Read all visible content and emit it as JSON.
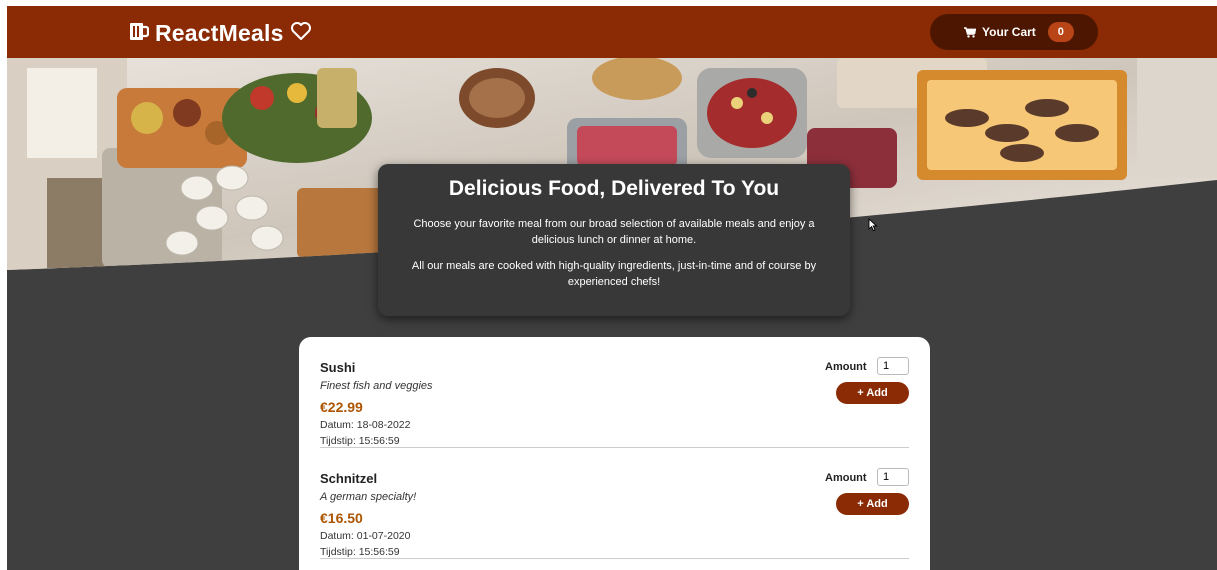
{
  "header": {
    "brand": "ReactMeals",
    "brand_icon": "beer-mug-icon",
    "brand_suffix_icon": "heart-outline-icon",
    "cart_label": "Your Cart",
    "cart_icon": "shopping-cart-icon",
    "cart_count": "0"
  },
  "summary": {
    "title": "Delicious Food, Delivered To You",
    "paragraph1": "Choose your favorite meal from our broad selection of available meals and enjoy a delicious lunch or dinner at home.",
    "paragraph2": "All our meals are cooked with high-quality ingredients, just-in-time and of course by experienced chefs!"
  },
  "meals": [
    {
      "name": "Sushi",
      "description": "Finest fish and veggies",
      "price": "€22.99",
      "date": "Datum: 18-08-2022",
      "time": "Tijdstip: 15:56:59",
      "amount_label": "Amount",
      "amount_value": "1",
      "add_label": "+ Add"
    },
    {
      "name": "Schnitzel",
      "description": "A german specialty!",
      "price": "€16.50",
      "date": "Datum: 01-07-2020",
      "time": "Tijdstip: 15:56:59",
      "amount_label": "Amount",
      "amount_value": "1",
      "add_label": "+ Add"
    }
  ],
  "colors": {
    "header": "#8a2b06",
    "cart_button": "#4d1601",
    "badge": "#b94517",
    "background": "#3f3f3f",
    "price": "#ad5502"
  }
}
